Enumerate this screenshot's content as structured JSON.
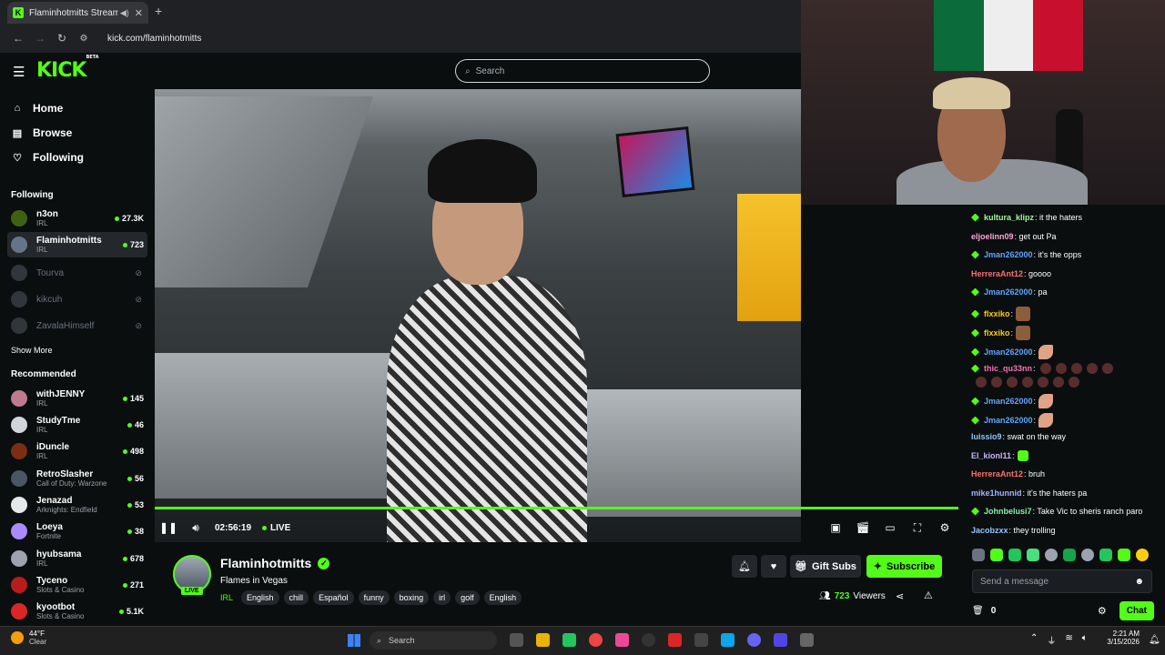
{
  "browser": {
    "tab_title": "Flaminhotmitts Stream - Wa",
    "url": "kick.com/flaminhotmitts"
  },
  "site": {
    "logo": "KICK",
    "logo_badge": "BETA",
    "search_placeholder": "Search"
  },
  "sidebar": {
    "nav": [
      {
        "label": "Home",
        "icon": "home-icon"
      },
      {
        "label": "Browse",
        "icon": "browse-icon"
      },
      {
        "label": "Following",
        "icon": "heart-icon"
      }
    ],
    "following_title": "Following",
    "following": [
      {
        "name": "n3on",
        "category": "IRL",
        "viewers": "27.3K",
        "live": true
      },
      {
        "name": "Flaminhotmitts",
        "category": "IRL",
        "viewers": "723",
        "live": true
      },
      {
        "name": "Tourva",
        "category": "",
        "viewers": "",
        "live": false
      },
      {
        "name": "kikcuh",
        "category": "",
        "viewers": "",
        "live": false
      },
      {
        "name": "ZavalaHimself",
        "category": "",
        "viewers": "",
        "live": false
      }
    ],
    "show_more": "Show More",
    "recommended_title": "Recommended",
    "recommended": [
      {
        "name": "withJENNY",
        "category": "IRL",
        "viewers": "145"
      },
      {
        "name": "StudyTme",
        "category": "IRL",
        "viewers": "46"
      },
      {
        "name": "iDuncle",
        "category": "IRL",
        "viewers": "498"
      },
      {
        "name": "RetroSlasher",
        "category": "Call of Duty: Warzone",
        "viewers": "56"
      },
      {
        "name": "Jenazad",
        "category": "Arknights: Endfield",
        "viewers": "53"
      },
      {
        "name": "Loeya",
        "category": "Fortnite",
        "viewers": "38"
      },
      {
        "name": "hyubsama",
        "category": "IRL",
        "viewers": "678"
      },
      {
        "name": "Tyceno",
        "category": "Slots & Casino",
        "viewers": "271"
      },
      {
        "name": "kyootbot",
        "category": "Slots & Casino",
        "viewers": "5.1K"
      }
    ]
  },
  "player": {
    "time": "02:56:19",
    "live_label": "LIVE",
    "progress": 1.0
  },
  "streamer": {
    "name": "Flaminhotmitts",
    "live_badge": "LIVE",
    "title": "Flames in Vegas",
    "category": "IRL",
    "tags": [
      "English",
      "chill",
      "Español",
      "funny",
      "boxing",
      "irl",
      "golf",
      "English"
    ],
    "gift_label": "Gift Subs",
    "subscribe_label": "Subscribe",
    "viewers": "723",
    "viewers_label": "Viewers"
  },
  "chat": {
    "messages": [
      {
        "user": "kultura_klipz",
        "text": ": it the haters",
        "color": "#a5f3a0",
        "badge": true
      },
      {
        "user": "eljoelinn09",
        "text": ": get out Pa",
        "color": "#f9a8d4",
        "badge": false
      },
      {
        "user": "Jman262000",
        "text": ": it's the opps",
        "color": "#60a5fa",
        "badge": true
      },
      {
        "user": "HerreraAnt12",
        "text": ": goooo",
        "color": "#f87171",
        "badge": false
      },
      {
        "user": "Jman262000",
        "text": ": pa",
        "color": "#60a5fa",
        "badge": true
      },
      {
        "user": "flxxiko",
        "text": ":",
        "color": "#facc15",
        "badge": true,
        "emote": "face"
      },
      {
        "user": "flxxiko",
        "text": ":",
        "color": "#facc15",
        "badge": true,
        "emote": "face"
      },
      {
        "user": "Jman262000",
        "text": ":",
        "color": "#60a5fa",
        "badge": true,
        "emote": "hand"
      },
      {
        "user": "thic_qu33nn",
        "text": ":",
        "color": "#f472b6",
        "badge": true,
        "emote": "dark"
      },
      {
        "user": "Jman262000",
        "text": ":",
        "color": "#60a5fa",
        "badge": true,
        "emote": "hand"
      },
      {
        "user": "Jman262000",
        "text": ":",
        "color": "#60a5fa",
        "badge": true,
        "emote": "hand"
      },
      {
        "user": "luissio9",
        "text": ": swat on the way",
        "color": "#93c5fd",
        "badge": false
      },
      {
        "user": "El_kionl11",
        "text": ":",
        "color": "#c4b5fd",
        "badge": false,
        "emote": "green"
      },
      {
        "user": "HerreraAnt12",
        "text": ": bruh",
        "color": "#f87171",
        "badge": false
      },
      {
        "user": "mike1hunnid",
        "text": ": it's the haters pa",
        "color": "#a5b4fc",
        "badge": false
      },
      {
        "user": "Johnbelusi7",
        "text": ": Take Vic to sheris ranch paro",
        "color": "#86efac",
        "badge": true
      },
      {
        "user": "Jacobzxx",
        "text": ": they trolling",
        "color": "#93c5fd",
        "badge": false
      }
    ],
    "input_placeholder": "Send a message",
    "points": "0",
    "chat_button": "Chat"
  },
  "taskbar": {
    "temp": "44°F",
    "weather": "Clear",
    "search": "Search",
    "time": "2:21 AM",
    "date": "3/15/2026"
  },
  "colors": {
    "accent": "#53fc18",
    "background": "#0b0e0f",
    "surface": "#24272c"
  }
}
